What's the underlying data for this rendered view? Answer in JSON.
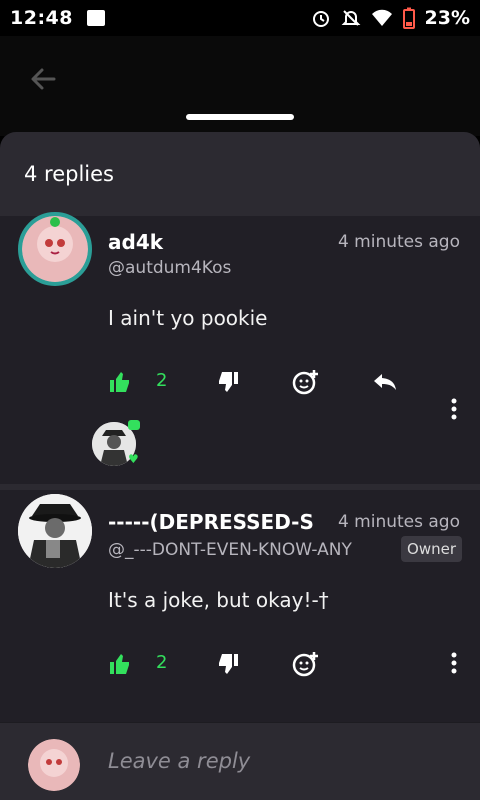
{
  "status_bar": {
    "time": "12:48",
    "battery": "23%"
  },
  "sheet": {
    "title": "4 replies"
  },
  "comments": [
    {
      "name": "ad4k",
      "handle": "@autdum4Kos",
      "time": "4 minutes ago",
      "text": "I ain't yo pookie",
      "likes": "2"
    },
    {
      "name": "-----(DEPRESSED-S",
      "handle": "@_---DONT-EVEN-KNOW-ANY",
      "time": "4 minutes ago",
      "badge": "Owner",
      "text": "It's a joke, but okay!-†",
      "likes": "2"
    }
  ],
  "reply": {
    "placeholder": "Leave a reply"
  },
  "colors": {
    "accent": "#33e05d",
    "sheet": "#2c2a31",
    "comment_bg": "#211f26"
  }
}
